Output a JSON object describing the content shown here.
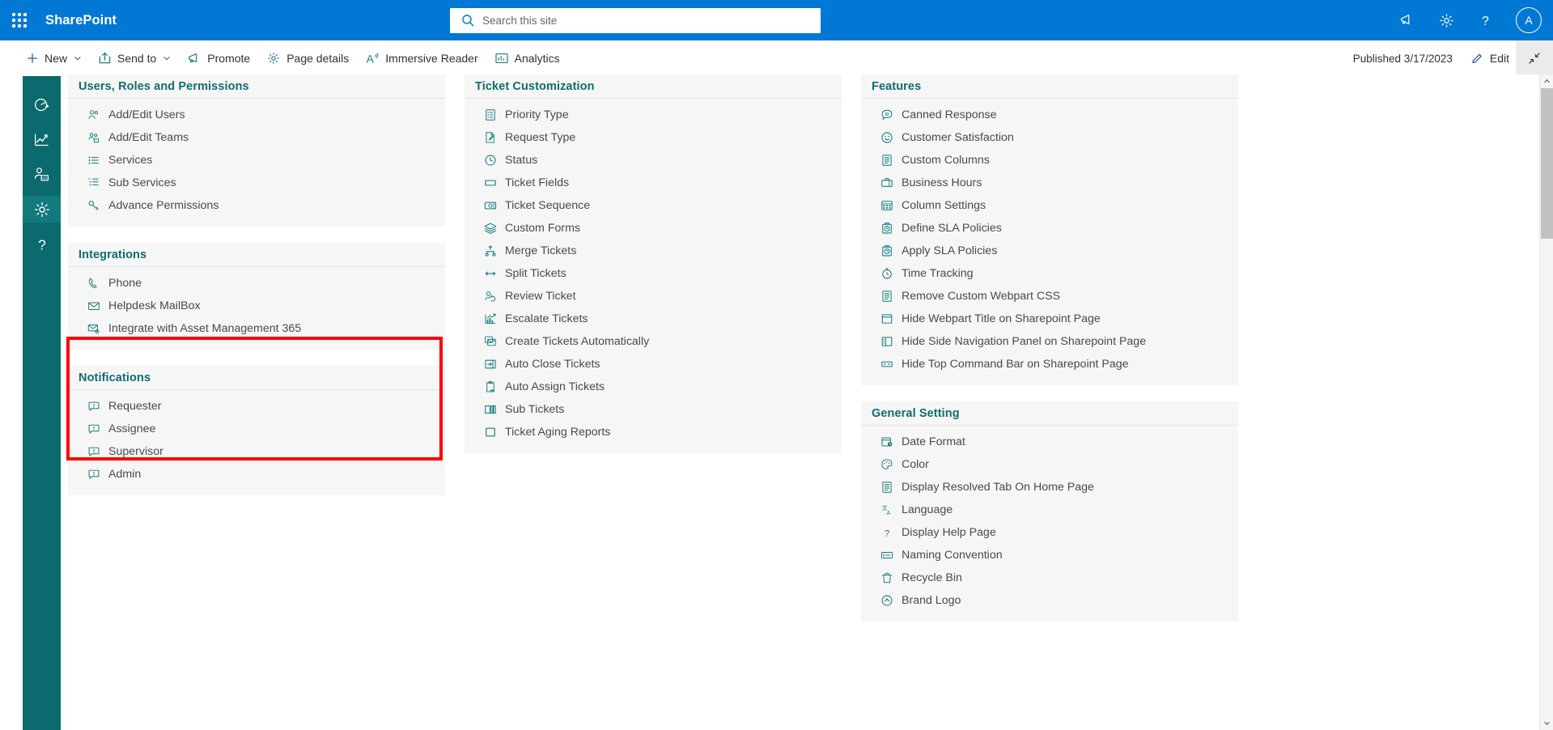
{
  "suite": {
    "title": "SharePoint",
    "waffle_label": "app-launcher",
    "search_placeholder": "Search this site",
    "search_value": "",
    "avatar_initial": "A"
  },
  "command_bar": {
    "items": [
      {
        "label": "New",
        "icon": "plus-icon",
        "has_chevron": true
      },
      {
        "label": "Send to",
        "icon": "share-icon",
        "has_chevron": true
      },
      {
        "label": "Promote",
        "icon": "megaphone-icon",
        "has_chevron": false
      },
      {
        "label": "Page details",
        "icon": "gear-icon",
        "has_chevron": false
      },
      {
        "label": "Immersive Reader",
        "icon": "immersive-reader-icon",
        "has_chevron": false
      },
      {
        "label": "Analytics",
        "icon": "analytics-icon",
        "has_chevron": false
      }
    ],
    "published_status": "Published 3/17/2023",
    "edit_label": "Edit",
    "collapse_label": "collapse"
  },
  "rail": {
    "items": [
      {
        "name": "dashboard",
        "icon": "speedometer-icon",
        "active": false
      },
      {
        "name": "reports",
        "icon": "line-chart-icon",
        "active": false
      },
      {
        "name": "agents",
        "icon": "person-settings-icon",
        "active": false
      },
      {
        "name": "settings",
        "icon": "gear-icon",
        "active": true
      },
      {
        "name": "help",
        "icon": "question-icon",
        "active": false
      }
    ]
  },
  "highlight": {
    "color": "#ff0000",
    "target": "notifications-card"
  },
  "columns": [
    {
      "name": "column-one",
      "cards": [
        {
          "id": "users-roles-permissions-card",
          "title": "Users, Roles and Permissions",
          "items": [
            {
              "label": "Add/Edit Users",
              "icon": "people-icon"
            },
            {
              "label": "Add/Edit Teams",
              "icon": "team-icon"
            },
            {
              "label": "Services",
              "icon": "bullet-list-icon"
            },
            {
              "label": "Sub Services",
              "icon": "sub-list-icon"
            },
            {
              "label": "Advance Permissions",
              "icon": "key-icon"
            }
          ]
        },
        {
          "id": "integrations-card",
          "title": "Integrations",
          "items": [
            {
              "label": "Phone",
              "icon": "phone-icon"
            },
            {
              "label": "Helpdesk MailBox",
              "icon": "mail-icon"
            },
            {
              "label": "Integrate with Asset Management 365",
              "icon": "mail-gear-icon"
            }
          ]
        },
        {
          "id": "notifications-card",
          "title": "Notifications",
          "items": [
            {
              "label": "Requester",
              "icon": "comment-alert-icon"
            },
            {
              "label": "Assignee",
              "icon": "comment-alert-icon"
            },
            {
              "label": "Supervisor",
              "icon": "comment-alert-icon"
            },
            {
              "label": "Admin",
              "icon": "comment-alert-icon"
            }
          ]
        }
      ]
    },
    {
      "name": "column-two",
      "cards": [
        {
          "id": "ticket-customization-card",
          "title": "Ticket Customization",
          "items": [
            {
              "label": "Priority Type",
              "icon": "checklist-icon"
            },
            {
              "label": "Request Type",
              "icon": "page-edit-icon"
            },
            {
              "label": "Status",
              "icon": "clock-check-icon"
            },
            {
              "label": "Ticket Fields",
              "icon": "ticket-icon"
            },
            {
              "label": "Ticket Sequence",
              "icon": "money-icon"
            },
            {
              "label": "Custom Forms",
              "icon": "layers-icon"
            },
            {
              "label": "Merge Tickets",
              "icon": "merge-icon"
            },
            {
              "label": "Split Tickets",
              "icon": "split-arrows-icon"
            },
            {
              "label": "Review Ticket",
              "icon": "person-sync-icon"
            },
            {
              "label": "Escalate Tickets",
              "icon": "bar-chart-arrow-icon"
            },
            {
              "label": "Create Tickets Automatically",
              "icon": "mail-copy-icon"
            },
            {
              "label": "Auto Close Tickets",
              "icon": "arrow-in-box-icon"
            },
            {
              "label": "Auto Assign Tickets",
              "icon": "clipboard-arrow-icon"
            },
            {
              "label": "Sub Tickets",
              "icon": "columns-icon"
            },
            {
              "label": "Ticket Aging Reports",
              "icon": "square-icon"
            }
          ]
        }
      ]
    },
    {
      "name": "column-three",
      "cards": [
        {
          "id": "features-card",
          "title": "Features",
          "items": [
            {
              "label": "Canned Response",
              "icon": "comment-lines-icon"
            },
            {
              "label": "Customer Satisfaction",
              "icon": "smiley-icon"
            },
            {
              "label": "Custom Columns",
              "icon": "document-list-icon"
            },
            {
              "label": "Business Hours",
              "icon": "briefcase-icon"
            },
            {
              "label": "Column Settings",
              "icon": "grid-settings-icon"
            },
            {
              "label": "Define SLA Policies",
              "icon": "timer-box-icon"
            },
            {
              "label": "Apply SLA Policies",
              "icon": "timer-box-icon"
            },
            {
              "label": "Time Tracking",
              "icon": "stopwatch-icon"
            },
            {
              "label": "Remove Custom Webpart CSS",
              "icon": "document-list-icon"
            },
            {
              "label": "Hide Webpart Title on Sharepoint Page",
              "icon": "webpart-icon"
            },
            {
              "label": "Hide Side Navigation Panel on Sharepoint Page",
              "icon": "side-nav-icon"
            },
            {
              "label": "Hide Top Command Bar on Sharepoint Page",
              "icon": "command-bar-icon"
            }
          ]
        },
        {
          "id": "general-setting-card",
          "title": "General Setting",
          "items": [
            {
              "label": "Date Format",
              "icon": "calendar-clock-icon"
            },
            {
              "label": "Color",
              "icon": "palette-icon"
            },
            {
              "label": "Display Resolved Tab On Home Page",
              "icon": "document-list-icon"
            },
            {
              "label": "Language",
              "icon": "language-icon"
            },
            {
              "label": "Display Help Page",
              "icon": "question-icon"
            },
            {
              "label": "Naming Convention",
              "icon": "naming-icon"
            },
            {
              "label": "Recycle Bin",
              "icon": "recycle-bin-icon"
            },
            {
              "label": "Brand Logo",
              "icon": "brand-logo-icon"
            }
          ]
        }
      ]
    }
  ]
}
